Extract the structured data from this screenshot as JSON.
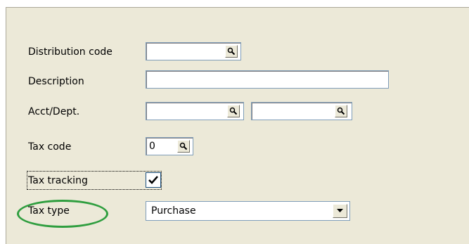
{
  "form": {
    "distribution_code": {
      "label": "Distribution code",
      "value": ""
    },
    "description": {
      "label": "Description",
      "value": ""
    },
    "acct_dept": {
      "label": "Acct/Dept.",
      "acct_value": "",
      "dept_value": ""
    },
    "tax_code": {
      "label": "Tax code",
      "value": "0"
    },
    "tax_tracking": {
      "label": "Tax tracking",
      "checked": true
    },
    "tax_type": {
      "label": "Tax type",
      "selected": "Purchase"
    }
  },
  "annotation": {
    "highlight_color": "#2f9e3f",
    "highlighted_field": "tax_type"
  },
  "icons": [
    "search-icon",
    "checkmark-icon",
    "chevron-down-icon"
  ]
}
